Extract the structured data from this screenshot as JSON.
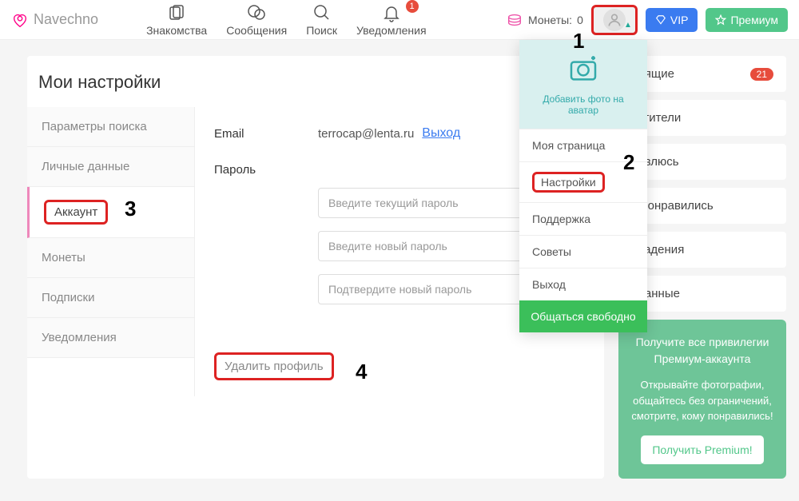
{
  "brand": "Navechno",
  "nav": {
    "dating": "Знакомства",
    "messages": "Сообщения",
    "search": "Поиск",
    "notifications": "Уведомления",
    "notif_badge": "1"
  },
  "header": {
    "coins_label": "Монеты:",
    "coins_value": "0",
    "vip": "VIP",
    "premium": "Премиум"
  },
  "page": {
    "title": "Мои настройки"
  },
  "tabs": {
    "search_params": "Параметры поиска",
    "personal": "Личные данные",
    "account": "Аккаунт",
    "coins": "Монеты",
    "subs": "Подписки",
    "notifs": "Уведомления"
  },
  "account": {
    "email_label": "Email",
    "email_value": "terrocap@lenta.ru",
    "logout": "Выход",
    "password_label": "Пароль",
    "pw_current": "Введите текущий пароль",
    "pw_new": "Введите новый пароль",
    "pw_confirm": "Подтвердите новый пароль",
    "delete_profile": "Удалить профиль"
  },
  "dropdown": {
    "add_photo": "Добавить фото на аватар",
    "my_page": "Моя страница",
    "settings": "Настройки",
    "support": "Поддержка",
    "tips": "Советы",
    "logout": "Выход",
    "chat_free": "Общаться свободно"
  },
  "right": {
    "incoming": "одящие",
    "incoming_badge": "21",
    "visitors": "сетители",
    "i_like": "равлюсь",
    "liked_me": "е понравились",
    "matches": "впадения",
    "favorites": "бранные"
  },
  "promo": {
    "title": "Получите все привилегии Премиум-аккаунта",
    "text": "Открывайте фотографии, общайтесь без ограничений, смотрите, кому понравились!",
    "button": "Получить Premium!"
  },
  "anno": {
    "n1": "1",
    "n2": "2",
    "n3": "3",
    "n4": "4"
  }
}
